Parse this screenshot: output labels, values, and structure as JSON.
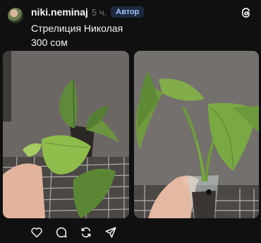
{
  "post": {
    "username": "niki.neminaj",
    "time": "5 ч.",
    "author_badge": "Автор",
    "caption_line1": "Стрелиция Николая",
    "caption_line2": "300 сом"
  },
  "images": [
    {
      "subject": "strelitzia-plant-in-pot"
    },
    {
      "subject": "strelitzia-plant-held-in-cup"
    }
  ],
  "actions": [
    "like-icon",
    "reply-icon",
    "repost-icon",
    "share-icon"
  ],
  "colors": {
    "background": "#101010",
    "text": "#f3f5f7",
    "muted": "#777777",
    "badge_text": "#9ec2ff"
  }
}
